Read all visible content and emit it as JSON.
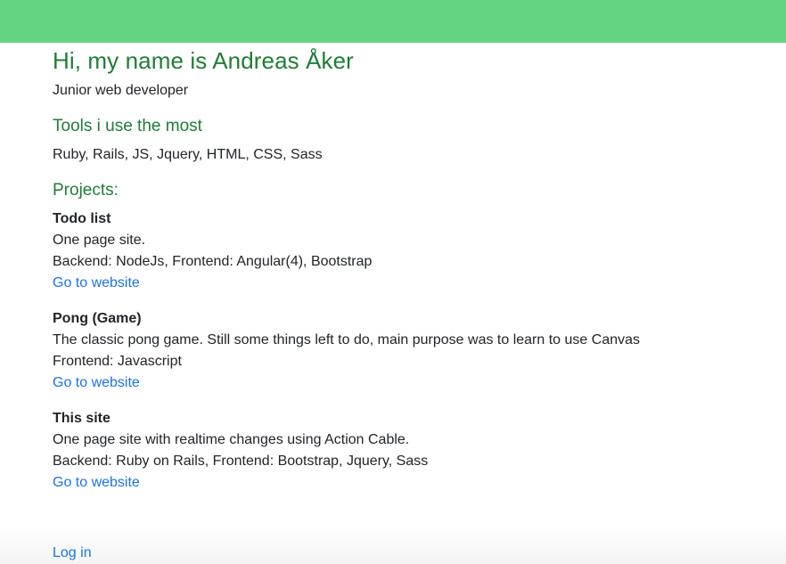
{
  "header": {
    "bar_color": "#63d47f"
  },
  "intro": {
    "title": "Hi, my name is Andreas Åker",
    "subtitle": "Junior web developer"
  },
  "tools": {
    "heading": "Tools i use the most",
    "text": "Ruby, Rails, JS, Jquery, HTML, CSS, Sass"
  },
  "projects": {
    "heading": "Projects:",
    "items": [
      {
        "name": "Todo list",
        "description": "One page site.",
        "stack": "Backend: NodeJs, Frontend: Angular(4), Bootstrap",
        "link": "Go to website"
      },
      {
        "name": "Pong (Game)",
        "description": "The classic pong game. Still some things left to do, main purpose was to learn to use Canvas",
        "stack": "Frontend: Javascript",
        "link": "Go to website"
      },
      {
        "name": "This site",
        "description": "One page site with realtime changes using Action Cable.",
        "stack": "Backend: Ruby on Rails, Frontend: Bootstrap, Jquery, Sass",
        "link": "Go to website"
      }
    ]
  },
  "footer": {
    "login_label": "Log in"
  },
  "colors": {
    "heading_green": "#1e7e34",
    "link_blue": "#1a73e8"
  }
}
